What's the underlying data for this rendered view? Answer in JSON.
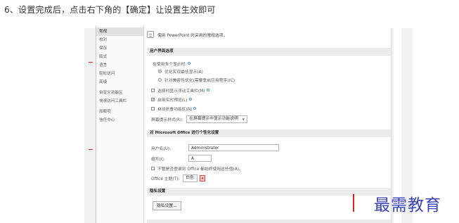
{
  "caption": "6、设置完成后，点击右下角的【确定】让设置生效即可",
  "nav_items": [
    {
      "label": "常规",
      "active": true
    },
    {
      "label": "校对"
    },
    {
      "label": "保存"
    },
    {
      "label": "版式"
    },
    {
      "label": "语言"
    },
    {
      "label": "轻松访问"
    },
    {
      "label": "高级"
    },
    {
      "label": "自定义功能区"
    },
    {
      "label": "快速访问工具栏"
    },
    {
      "label": "加载项"
    },
    {
      "label": "信任中心"
    }
  ],
  "intro_text": "使用 PowerPoint 时采用的常规选项。",
  "ui_section": {
    "title": "用户界面选项",
    "multi_display_label": "在使用多个显示时:",
    "radio_optimal": "优化实现最佳显示(A)",
    "radio_compat": "针对兼容性优化(需要重启应用程序)(C)",
    "chk_minitoolbar": "选择时显示浮动工具栏(M)",
    "chk_livepreview": "启用实时预览(L)",
    "chk_collapse": "自动折叠功能区(N)",
    "tooltip_label": "屏幕提示样式(R):",
    "tooltip_value": "在屏幕提示中显示功能说明"
  },
  "personal_section": {
    "title": "对 Microsoft Office 进行个性化设置",
    "username_label": "用户名(U):",
    "username_value": "Administrator",
    "initials_label": "缩写(I):",
    "initials_value": "A",
    "always_use_label": "不管是否登录到 Office 都始终使用这些值(A)。",
    "theme_label": "Office 主题(T):",
    "theme_value": "白色"
  },
  "privacy_section": {
    "title": "隐私设置",
    "button_label": "隐私设置..."
  },
  "watermark": "最需教育"
}
